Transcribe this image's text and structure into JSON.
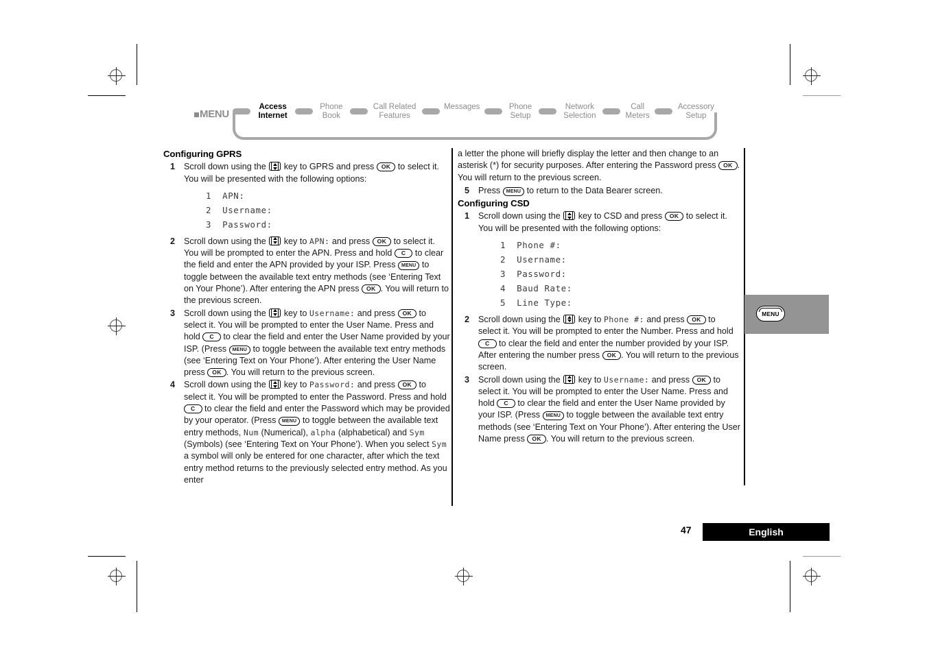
{
  "nav": {
    "menu_label": "MENU",
    "items": [
      {
        "label": "Access\nInternet",
        "current": true
      },
      {
        "label": "Phone\nBook",
        "current": false
      },
      {
        "label": "Call Related\nFeatures",
        "current": false
      },
      {
        "label": "Messages",
        "current": false
      },
      {
        "label": "Phone\nSetup",
        "current": false
      },
      {
        "label": "Network\nSelection",
        "current": false
      },
      {
        "label": "Call\nMeters",
        "current": false
      },
      {
        "label": "Accessory\nSetup",
        "current": false
      }
    ]
  },
  "left_column": {
    "heading": "Configuring GPRS",
    "step1": {
      "num": "1",
      "t1": "Scroll down using the ",
      "t2": " key to GPRS and press ",
      "t3": " to select it. You will be presented with the following options:",
      "options": [
        "1  APN:",
        "2  Username:",
        "3  Password:"
      ]
    },
    "step2": {
      "num": "2",
      "t1": "Scroll down using the ",
      "t2": " key to ",
      "mono1": "APN:",
      "t3": " and press ",
      "t4": " to select it. You will be prompted to enter the APN. Press and hold ",
      "t5": " to clear the field and enter the APN provided by your ISP. Press ",
      "t6": " to toggle between the available text entry methods (see ‘Entering Text on Your Phone’). After entering the APN press ",
      "t7": ". You will return to the previous screen."
    },
    "step3": {
      "num": "3",
      "t1": "Scroll down using the ",
      "t2": " key to ",
      "mono1": "Username:",
      "t3": " and press ",
      "t4": " to select it. You will be prompted to enter the User Name. Press and hold ",
      "t5": " to clear the field and enter the User Name provided by your ISP. (Press ",
      "t6": " to toggle between the available text entry methods (see ‘Entering Text on Your Phone’). After entering the User Name press ",
      "t7": ". You will return to the previous screen."
    },
    "step4": {
      "num": "4",
      "t1": "Scroll down using the ",
      "t2": " key to ",
      "mono1": "Password:",
      "t3": " and press ",
      "t4": " to select it. You will be prompted to enter the Password. Press and hold ",
      "t5": " to clear the field and enter the Password which may be provided by your operator. (Press ",
      "t6": " to toggle between the available text entry methods, ",
      "mono2": "Num",
      "t7": " (Numerical), ",
      "mono3": "alpha",
      "t8": " (alphabetical) and ",
      "mono4": "Sym",
      "t9": " (Symbols) (see ‘Entering Text on Your Phone’). When you select ",
      "mono5": "Sym",
      "t10": " a symbol will only be entered for one character, after which the text entry method returns to the previously selected entry method. As you enter"
    }
  },
  "right_column": {
    "continuation": {
      "t1": "a letter the phone will briefly display the letter and then change to an asterisk (*) for security purposes. After entering the Password press ",
      "t2": ". You will return to the previous screen."
    },
    "step5": {
      "num": "5",
      "t1": "Press ",
      "t2": " to return to the Data Bearer screen."
    },
    "heading": "Configuring CSD",
    "step1": {
      "num": "1",
      "t1": "Scroll down using the ",
      "t2": " key to CSD and press ",
      "t3": " to select it. You will be presented with the following options:",
      "options": [
        "1  Phone #:",
        "2  Username:",
        "3  Password:",
        "4  Baud Rate:",
        "5  Line Type:"
      ]
    },
    "step2": {
      "num": "2",
      "t1": "Scroll down using the ",
      "t2": " key to ",
      "mono1": "Phone #:",
      "t3": " and press ",
      "t4": " to select it. You will be prompted to enter the Number. Press and hold ",
      "t5": " to clear the field and enter the number provided by your ISP. After entering the number press ",
      "t6": ". You will return to the previous screen."
    },
    "step3": {
      "num": "3",
      "t1": "Scroll down using the ",
      "t2": " key to ",
      "mono1": "Username:",
      "t3": " and press ",
      "t4": " to select it. You will be prompted to enter the User Name. Press and hold ",
      "t5": " to clear the field and enter the User Name provided by your ISP. (Press ",
      "t6": " to toggle between the available text entry methods (see ‘Entering Text on Your Phone’). After entering the User Name press ",
      "t7": ". You will return to the previous screen."
    }
  },
  "side_tab": {
    "label": "MENU"
  },
  "footer": {
    "page_number": "47",
    "language": "English"
  },
  "keys": {
    "ok": "OK",
    "clear": "C",
    "menu": "MENU"
  }
}
